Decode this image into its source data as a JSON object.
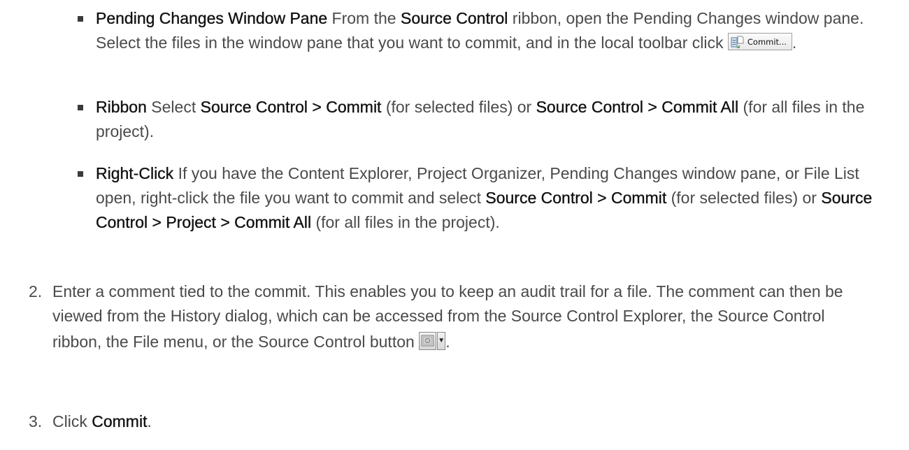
{
  "bullets": [
    {
      "title": "Pending Changes Window Pane",
      "t1": " From the ",
      "b1": "Source Control",
      "t2": " ribbon, open the Pending Changes window pane. Select the files in the window pane that you want to commit, and in the local toolbar click ",
      "button_label": "Commit...",
      "t3": "."
    },
    {
      "title": "Ribbon",
      "t1": " Select ",
      "b1": "Source Control > Commit",
      "t2": " (for selected files) or ",
      "b2": "Source Control > Commit All",
      "t3": " (for all files in the project)."
    },
    {
      "title": "Right-Click",
      "t1": " If you have the Content Explorer, Project Organizer, Pending Changes window pane, or File List open, right-click the file you want to commit and select ",
      "b1": "Source Control > Commit",
      "t2": " (for selected files) or ",
      "b2": "Source Control > Project > Commit All",
      "t3": " (for all files in the project)."
    }
  ],
  "steps": [
    {
      "number": "2.",
      "text": "Enter a comment tied to the commit. This enables you to keep an audit trail for a file. The comment can then be viewed from the History dialog, which can be accessed from the Source Control Explorer, the Source Control ribbon, the File menu, or the Source Control button ",
      "text_end": "."
    },
    {
      "number": "3.",
      "text": "Click ",
      "bold": "Commit",
      "text_end": "."
    }
  ]
}
